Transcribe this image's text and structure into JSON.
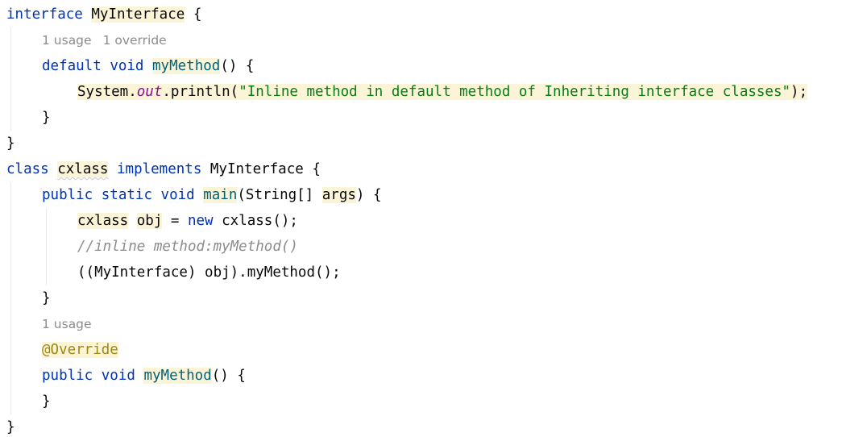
{
  "editor": {
    "language": "Java",
    "colors": {
      "background": "#ffffff",
      "keyword": "#0033b3",
      "string": "#067d17",
      "annotation": "#9e880d",
      "comment": "#8c8c8c",
      "static_field": "#871094",
      "declaration": "#00627a",
      "highlight": "#fcf4d6"
    },
    "lines": [
      {
        "kind": "code",
        "indent": 0,
        "tokens": [
          {
            "text": "interface",
            "type": "kw"
          },
          {
            "text": " ",
            "type": "plain"
          },
          {
            "text": "MyInterface",
            "type": "plain",
            "hl": true
          },
          {
            "text": " {",
            "type": "plain"
          }
        ]
      },
      {
        "kind": "hint",
        "indent": 1,
        "hints": [
          "1 usage",
          "1 override"
        ]
      },
      {
        "kind": "code",
        "indent": 1,
        "tokens": [
          {
            "text": "default",
            "type": "kw"
          },
          {
            "text": " ",
            "type": "plain"
          },
          {
            "text": "void",
            "type": "kw"
          },
          {
            "text": " ",
            "type": "plain"
          },
          {
            "text": "myMethod",
            "type": "decl",
            "hl": true
          },
          {
            "text": "() {",
            "type": "plain"
          }
        ]
      },
      {
        "kind": "code",
        "indent": 2,
        "tokens": [
          {
            "text": "System.",
            "type": "plain",
            "hl": true
          },
          {
            "text": "out",
            "type": "static-field",
            "hl": true
          },
          {
            "text": ".println(",
            "type": "plain",
            "hl": true
          },
          {
            "text": "\"Inline method in default method of Inheriting interface classes\"",
            "type": "str",
            "hl": true
          },
          {
            "text": ");",
            "type": "plain",
            "hl": true
          }
        ]
      },
      {
        "kind": "code",
        "indent": 1,
        "tokens": [
          {
            "text": "}",
            "type": "plain"
          }
        ]
      },
      {
        "kind": "code",
        "indent": 0,
        "tokens": [
          {
            "text": "}",
            "type": "plain"
          }
        ]
      },
      {
        "kind": "code",
        "indent": 0,
        "tokens": [
          {
            "text": "class",
            "type": "kw"
          },
          {
            "text": " ",
            "type": "plain"
          },
          {
            "text": "cxlass",
            "type": "plain",
            "hl": true,
            "warn": true
          },
          {
            "text": " ",
            "type": "plain"
          },
          {
            "text": "implements",
            "type": "kw"
          },
          {
            "text": " MyInterface {",
            "type": "plain"
          }
        ]
      },
      {
        "kind": "code",
        "indent": 1,
        "tokens": [
          {
            "text": "public",
            "type": "kw"
          },
          {
            "text": " ",
            "type": "plain"
          },
          {
            "text": "static",
            "type": "kw"
          },
          {
            "text": " ",
            "type": "plain"
          },
          {
            "text": "void",
            "type": "kw"
          },
          {
            "text": " ",
            "type": "plain"
          },
          {
            "text": "main",
            "type": "decl",
            "hl": true
          },
          {
            "text": "(String[] ",
            "type": "plain"
          },
          {
            "text": "args",
            "type": "plain",
            "hl": true
          },
          {
            "text": ") {",
            "type": "plain"
          }
        ]
      },
      {
        "kind": "code",
        "indent": 2,
        "tokens": [
          {
            "text": "cxlass",
            "type": "plain",
            "hl": true
          },
          {
            "text": " ",
            "type": "plain"
          },
          {
            "text": "obj",
            "type": "plain",
            "hl": true
          },
          {
            "text": " = ",
            "type": "plain"
          },
          {
            "text": "new",
            "type": "kw"
          },
          {
            "text": " cxlass();",
            "type": "plain"
          }
        ]
      },
      {
        "kind": "code",
        "indent": 2,
        "tokens": [
          {
            "text": "//inline method:myMethod()",
            "type": "comment"
          }
        ]
      },
      {
        "kind": "code",
        "indent": 2,
        "tokens": [
          {
            "text": "((MyInterface) obj).myMethod();",
            "type": "plain"
          }
        ]
      },
      {
        "kind": "code",
        "indent": 1,
        "tokens": [
          {
            "text": "}",
            "type": "plain"
          }
        ]
      },
      {
        "kind": "hint",
        "indent": 1,
        "hints": [
          "1 usage"
        ]
      },
      {
        "kind": "code",
        "indent": 1,
        "tokens": [
          {
            "text": "@Override",
            "type": "anno",
            "hl": true
          }
        ]
      },
      {
        "kind": "code",
        "indent": 1,
        "tokens": [
          {
            "text": "public",
            "type": "kw"
          },
          {
            "text": " ",
            "type": "plain"
          },
          {
            "text": "void",
            "type": "kw"
          },
          {
            "text": " ",
            "type": "plain"
          },
          {
            "text": "myMethod",
            "type": "decl",
            "hl": true
          },
          {
            "text": "() {",
            "type": "plain"
          }
        ]
      },
      {
        "kind": "code",
        "indent": 1,
        "tokens": [
          {
            "text": "}",
            "type": "plain"
          }
        ]
      },
      {
        "kind": "code",
        "indent": 0,
        "tokens": [
          {
            "text": "}",
            "type": "plain"
          }
        ]
      }
    ]
  }
}
